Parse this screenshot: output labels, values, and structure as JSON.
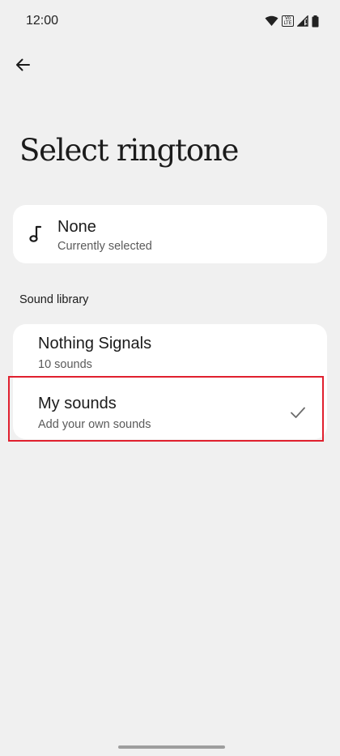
{
  "status_bar": {
    "time": "12:00",
    "volte_text": "Vo LTE",
    "icons": [
      "wifi-icon",
      "volte-icon",
      "signal-icon",
      "battery-icon"
    ]
  },
  "header": {
    "back_icon": "arrow-left-icon",
    "title": "Select ringtone"
  },
  "current": {
    "icon": "music-note-icon",
    "title": "None",
    "subtitle": "Currently selected"
  },
  "library": {
    "label": "Sound library",
    "items": [
      {
        "title": "Nothing Signals",
        "subtitle": "10 sounds",
        "selected": false
      },
      {
        "title": "My sounds",
        "subtitle": "Add your own sounds",
        "selected": true,
        "indicator_icon": "checkmark-icon"
      }
    ]
  },
  "colors": {
    "background": "#f0f0f0",
    "card": "#ffffff",
    "highlight": "#e0202e"
  }
}
